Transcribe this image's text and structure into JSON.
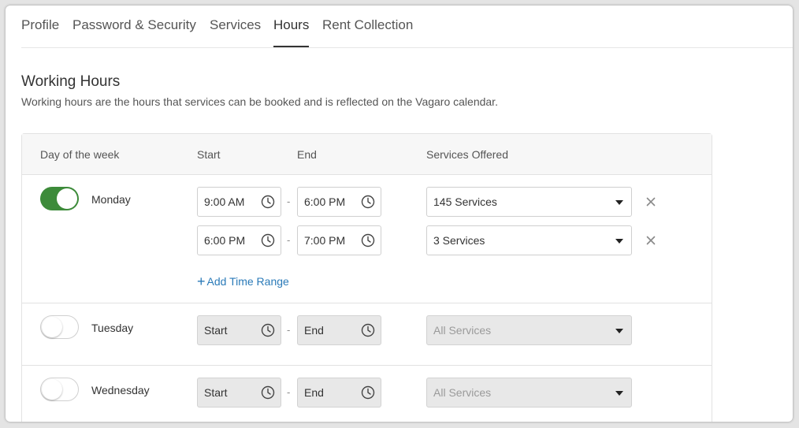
{
  "tabs": [
    {
      "label": "Profile"
    },
    {
      "label": "Password & Security"
    },
    {
      "label": "Services"
    },
    {
      "label": "Hours",
      "active": true
    },
    {
      "label": "Rent Collection"
    }
  ],
  "section": {
    "title": "Working Hours",
    "description": "Working hours are the hours that services can be booked and is reflected on the Vagaro calendar."
  },
  "table": {
    "headers": {
      "day": "Day of the week",
      "start": "Start",
      "end": "End",
      "services": "Services Offered"
    },
    "add_time_range_label": "Add Time Range",
    "days": [
      {
        "name": "Monday",
        "enabled": true,
        "ranges": [
          {
            "start": "9:00 AM",
            "end": "6:00 PM",
            "services": "145 Services"
          },
          {
            "start": "6:00 PM",
            "end": "7:00 PM",
            "services": "3 Services"
          }
        ]
      },
      {
        "name": "Tuesday",
        "enabled": false,
        "start_placeholder": "Start",
        "end_placeholder": "End",
        "services": "All Services"
      },
      {
        "name": "Wednesday",
        "enabled": false,
        "start_placeholder": "Start",
        "end_placeholder": "End",
        "services": "All Services"
      }
    ]
  },
  "colors": {
    "toggle_on": "#3d8b3a",
    "link": "#2a7ab8"
  },
  "icons": {
    "time": "clock-icon",
    "dropdown": "caret-down-icon",
    "remove": "close-icon",
    "add": "plus-icon"
  }
}
